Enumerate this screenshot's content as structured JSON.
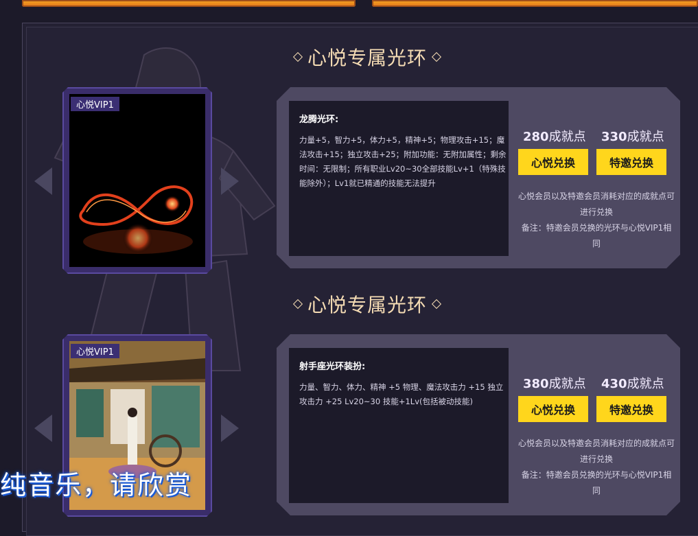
{
  "sections": [
    {
      "title": "心悦专属光环",
      "vip_tag": "心悦VIP1",
      "item_name": "龙腾光环:",
      "item_desc": "力量+5，智力+5，体力+5，精神+5；物理攻击+15；魔法攻击+15；独立攻击+25；附加功能：无附加属性；剩余时间：无限制；所有职业Lv20~30全部技能Lv+1（特殊技能除外）；Lv1就已精通的技能无法提升",
      "points_a": "280",
      "points_b": "330",
      "points_unit": "成就点",
      "btn_a": "心悦兑换",
      "btn_b": "特邀兑换",
      "note_1": "心悦会员以及特邀会员消耗对应的成就点可进行兑换",
      "note_2": "备注：特邀会员兑换的光环与心悦VIP1相同"
    },
    {
      "title": "心悦专属光环",
      "vip_tag": "心悦VIP1",
      "item_name": "射手座光环装扮:",
      "item_desc": "力量、智力、体力、精神 +5 物理、魔法攻击力 +15 独立攻击力 +25 Lv20~30 技能+1Lv(包括被动技能)",
      "points_a": "380",
      "points_b": "430",
      "points_unit": "成就点",
      "btn_a": "心悦兑换",
      "btn_b": "特邀兑换",
      "note_1": "心悦会员以及特邀会员消耗对应的成就点可进行兑换",
      "note_2": "备注：特邀会员兑换的光环与心悦VIP1相同"
    }
  ],
  "overlay_lyric": "纯音乐，请欣赏",
  "colors": {
    "accent_yellow": "#ffd61c",
    "title_gold": "#f5dcb4",
    "panel": "#4e4962",
    "background": "#1c1a29"
  }
}
